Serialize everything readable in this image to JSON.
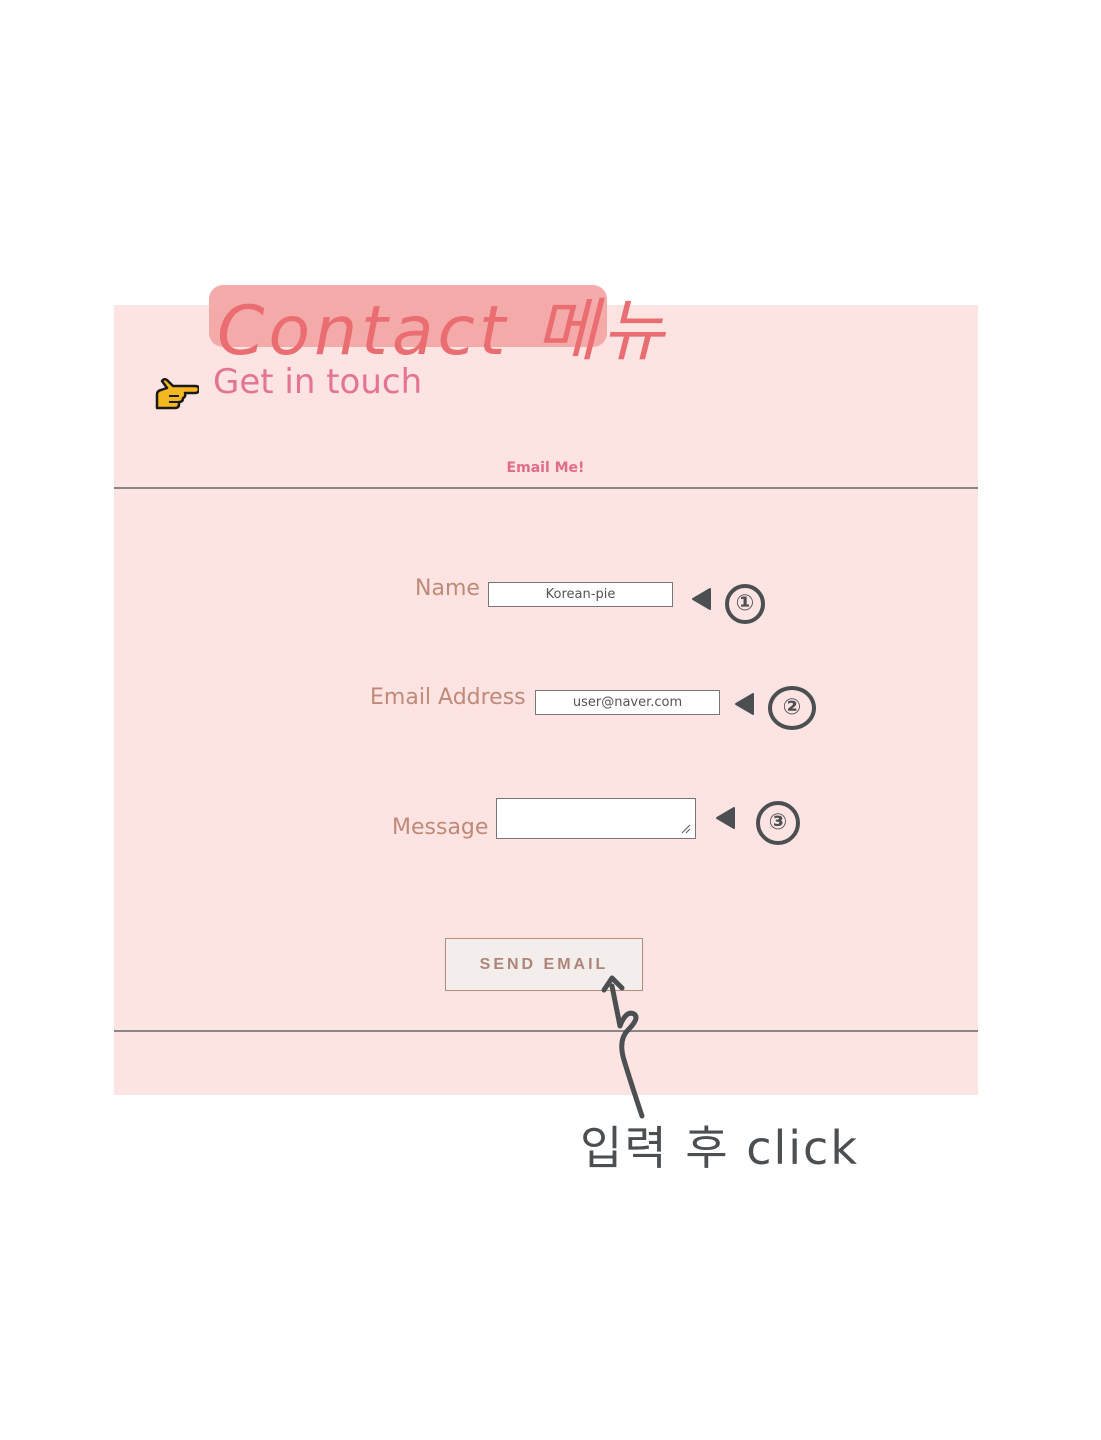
{
  "annotations": {
    "title_note": "Contact 메뉴",
    "field_markers": [
      "①",
      "②",
      "③"
    ],
    "click_note": "입력 후 click"
  },
  "header": {
    "heading": "Get in touch",
    "hand_icon": "pointing-hand-icon",
    "subheading": "Email Me!"
  },
  "form": {
    "name": {
      "label": "Name",
      "value": "Korean-pie"
    },
    "email": {
      "label": "Email Address",
      "value": "user@naver.com"
    },
    "message": {
      "label": "Message",
      "value": ""
    },
    "submit_label": "SEND EMAIL"
  },
  "colors": {
    "panel_bg": "#fde3e2",
    "highlight": "#f5a7a8",
    "heading": "#e37592",
    "label": "#bf8a78",
    "annotation_ink": "#4b4f52"
  }
}
